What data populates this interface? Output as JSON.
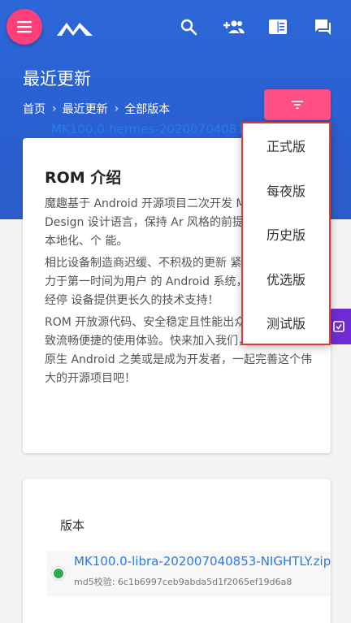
{
  "header": {
    "menu_icon": "hamburger-menu-icon",
    "logo_icon": "mokee-logo-icon",
    "actions": [
      "search-icon",
      "add-user-icon",
      "book-icon",
      "forum-icon"
    ]
  },
  "page": {
    "title": "最近更新",
    "breadcrumb": [
      "首页",
      "最近更新",
      "全部版本"
    ],
    "breadcrumb_sep": "›"
  },
  "filter": {
    "icon": "filter-list-icon",
    "options": [
      "正式版",
      "每夜版",
      "历史版",
      "优选版",
      "测试版"
    ]
  },
  "intro": {
    "title": "ROM 介绍",
    "paragraphs": [
      "魔趣基于 Android 开源项目二次开发 Material Design 设计语言，保持 Ar 风格的前提下增加了许多本地化、个 能。",
      "相比设备制造商迟缓、不积极的更新 紧随 Google，致力于第一时间为用户 的 Android 系统，为那些厂商已经停 设备提供更长久的技术支持！",
      "ROM 开放源代码、安全稳定且性能出众，将带给您极致流畅便捷的使用体验。快来加入我们，作为用户享受原生 Android 之美或是成为开发者，一起完善这个伟大的开源项目吧！"
    ]
  },
  "versions": {
    "label": "版本",
    "items": [
      {
        "name": "MK100.0-libra-202007040853-NIGHTLY.zip",
        "md5": "md5校验: 6c1b6997ceb9abda5d1f2065ef19d6a8"
      },
      {
        "name": "MK100.0-hermes-202007040812-NIGHTLY.zip"
      }
    ]
  },
  "colors": {
    "primary": "#2d67d8",
    "accent": "#ff4f86",
    "highlight_border": "#e53935",
    "side_tab": "#6f2bd6"
  }
}
